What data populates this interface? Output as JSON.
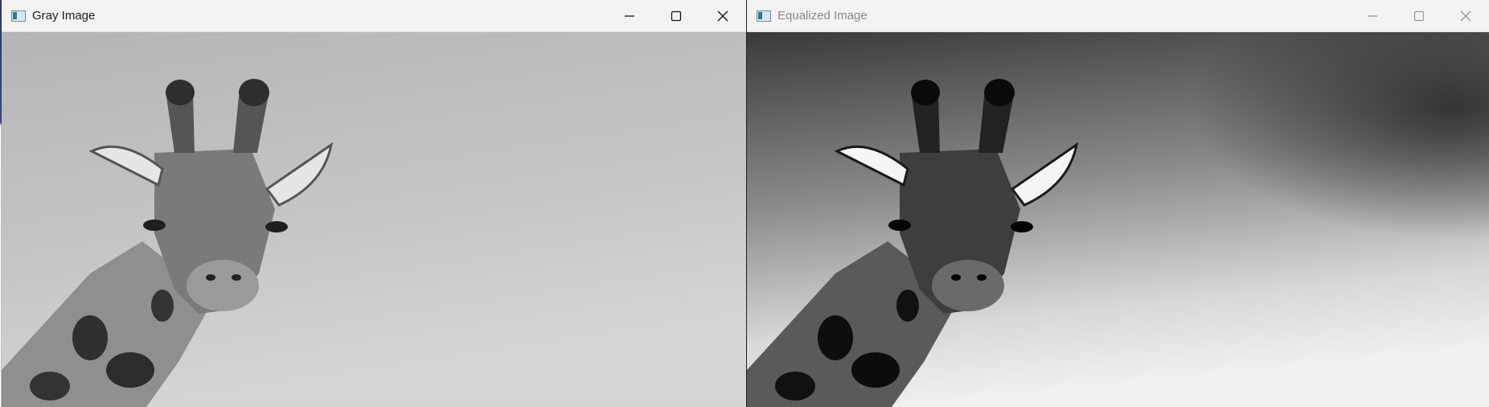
{
  "windows": {
    "gray": {
      "title": "Gray Image",
      "icons": {
        "app": "opencv-window-icon",
        "minimize": "minimize-icon",
        "maximize": "maximize-icon",
        "close": "close-icon"
      }
    },
    "equalized": {
      "title": "Equalized Image",
      "icons": {
        "app": "opencv-window-icon",
        "minimize": "minimize-icon",
        "maximize": "maximize-icon",
        "close": "close-icon"
      }
    }
  },
  "colors": {
    "titlebar": "#f3f3f3",
    "title_text_active": "#1a1a1a",
    "title_text_inactive": "#8a8a8a"
  }
}
